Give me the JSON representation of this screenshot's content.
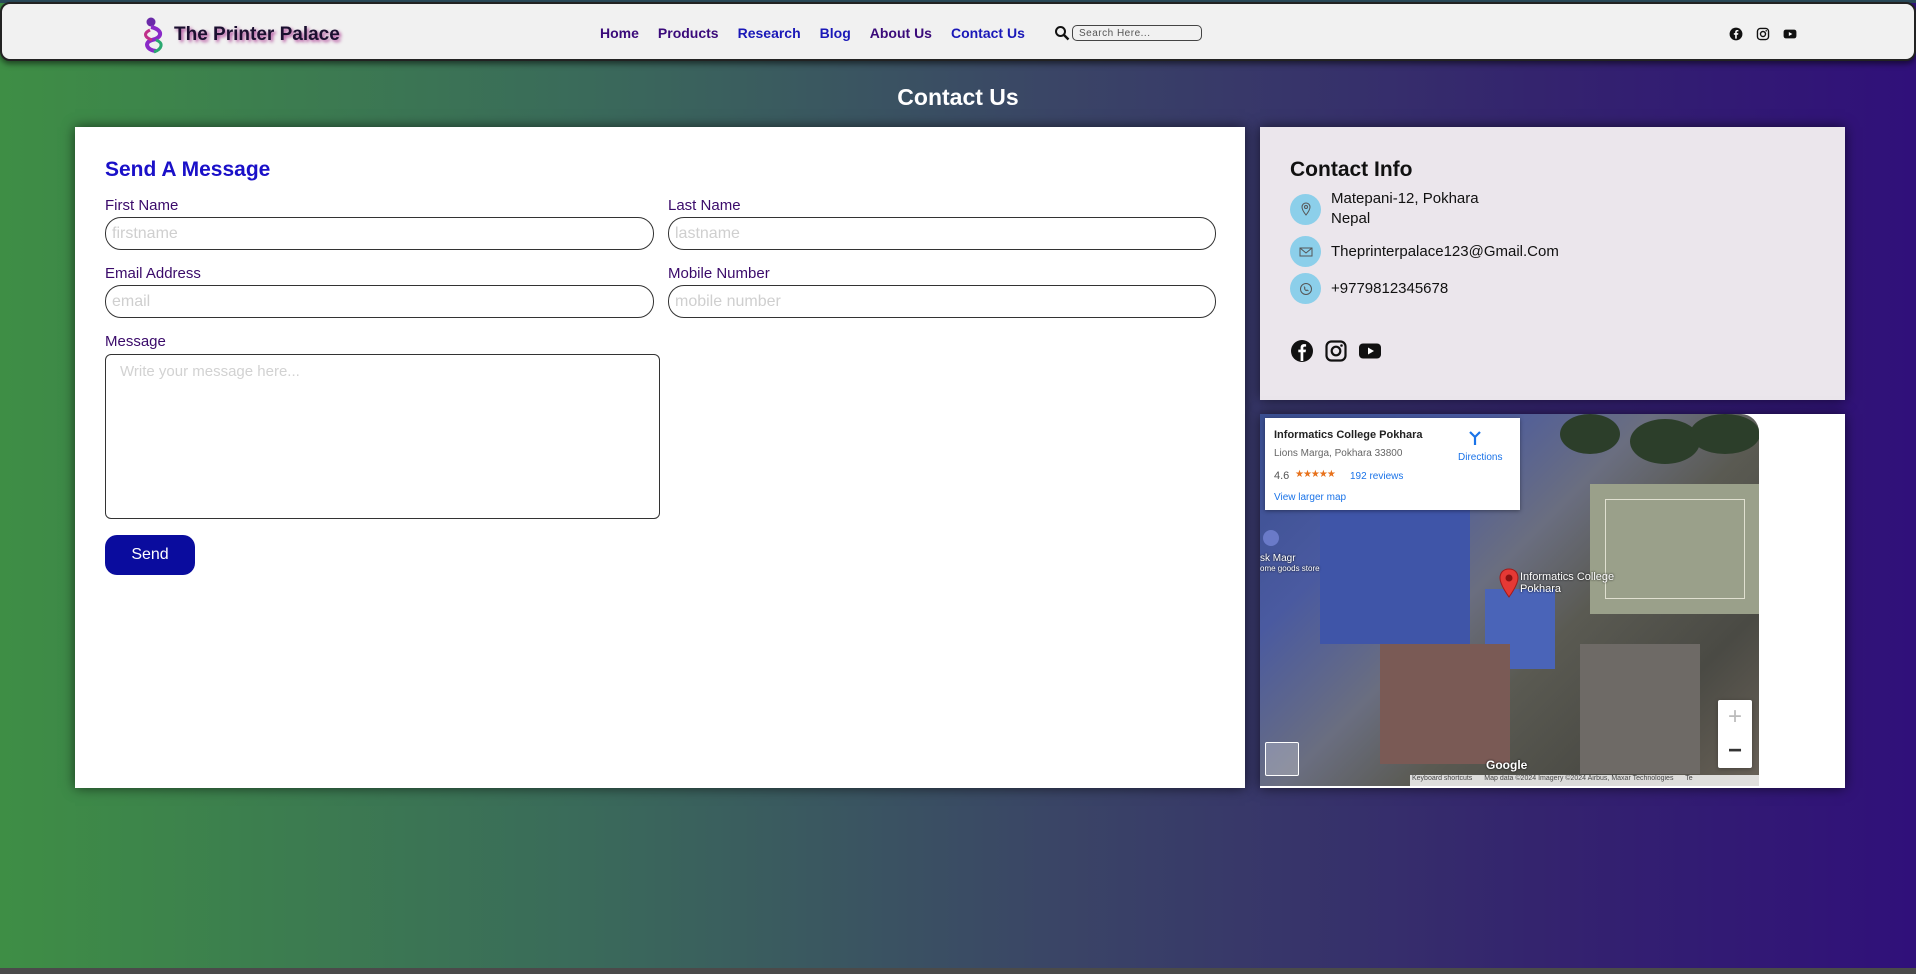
{
  "site": {
    "name": "The Printer Palace"
  },
  "nav": {
    "links": [
      "Home",
      "Products",
      "Research",
      "Blog",
      "About Us",
      "Contact Us"
    ],
    "search_placeholder": "Search Here..."
  },
  "page": {
    "title": "Contact Us"
  },
  "form": {
    "heading": "Send A Message",
    "first_name_label": "First Name",
    "first_name_placeholder": "firstname",
    "last_name_label": "Last Name",
    "last_name_placeholder": "lastname",
    "email_label": "Email Address",
    "email_placeholder": "email",
    "mobile_label": "Mobile Number",
    "mobile_placeholder": "mobile number",
    "message_label": "Message",
    "message_placeholder": "Write your message here...",
    "send_label": "Send"
  },
  "contact_info": {
    "heading": "Contact Info",
    "address_line1": "Matepani-12, Pokhara",
    "address_line2": "Nepal",
    "email": "Theprinterpalace123@Gmail.Com",
    "phone": "+9779812345678"
  },
  "map": {
    "place_name": "Informatics College Pokhara",
    "place_address": "Lions Marga, Pokhara 33800",
    "rating": "4.6",
    "stars": "★★★★★",
    "reviews": "192 reviews",
    "view_larger": "View larger map",
    "directions": "Directions",
    "pin_label": "Informatics College Pokhara",
    "side_label": "sk Magr",
    "side_sublabel": "ome goods store",
    "zoom_in": "+",
    "zoom_out": "−",
    "google": "Google",
    "footer_shortcuts": "Keyboard shortcuts",
    "footer_data": "Map data ©2024 Imagery ©2024 Airbus, Maxar Technologies",
    "footer_terms": "Te"
  },
  "colors": {
    "accent_blue": "#0a0c9e",
    "heading_blue": "#1a10c8",
    "nav_purple": "#3a0a7a",
    "icon_circle": "#8ccfea"
  },
  "icons": {
    "social": [
      "facebook-icon",
      "instagram-icon",
      "youtube-icon"
    ],
    "contact": [
      "location-pin-icon",
      "mail-icon",
      "phone-icon"
    ]
  }
}
